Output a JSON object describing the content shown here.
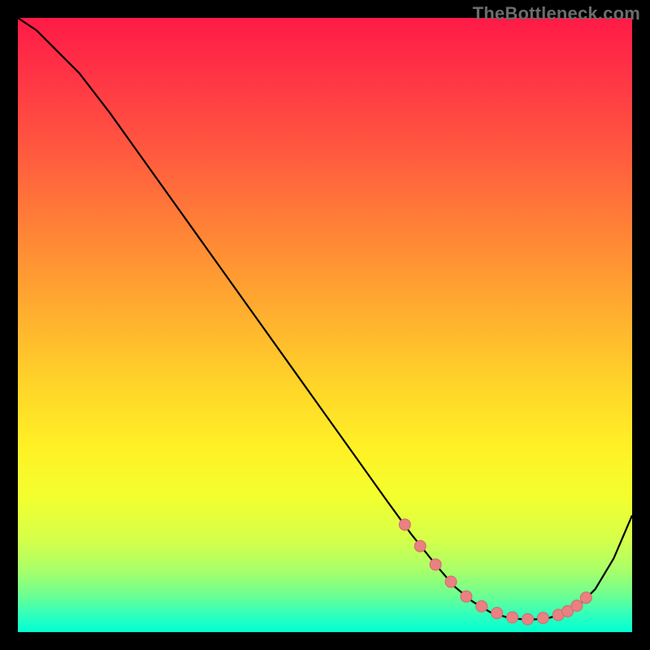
{
  "attribution": "TheBottleneck.com",
  "colors": {
    "bg": "#000000",
    "curve": "#000000",
    "marker_fill": "#e98081",
    "marker_stroke": "#d46a6c",
    "gradient_stops": [
      {
        "offset": 0.0,
        "color": "#ff1a46"
      },
      {
        "offset": 0.1,
        "color": "#ff3645"
      },
      {
        "offset": 0.22,
        "color": "#ff5a3f"
      },
      {
        "offset": 0.35,
        "color": "#ff8436"
      },
      {
        "offset": 0.48,
        "color": "#ffae2f"
      },
      {
        "offset": 0.6,
        "color": "#ffd529"
      },
      {
        "offset": 0.7,
        "color": "#fff126"
      },
      {
        "offset": 0.78,
        "color": "#f3ff2e"
      },
      {
        "offset": 0.85,
        "color": "#d5ff4a"
      },
      {
        "offset": 0.9,
        "color": "#a8ff6a"
      },
      {
        "offset": 0.94,
        "color": "#6dff92"
      },
      {
        "offset": 0.975,
        "color": "#2affc0"
      },
      {
        "offset": 1.0,
        "color": "#00ffd0"
      }
    ]
  },
  "chart_data": {
    "type": "line",
    "title": "",
    "xlabel": "",
    "ylabel": "",
    "xlim": [
      0,
      100
    ],
    "ylim": [
      0,
      100
    ],
    "series": [
      {
        "name": "curve",
        "x": [
          0,
          3,
          6,
          10,
          15,
          20,
          25,
          30,
          35,
          40,
          45,
          50,
          55,
          60,
          64,
          68,
          71,
          74,
          77,
          80,
          83,
          86,
          89,
          91.5,
          94,
          97,
          100
        ],
        "y": [
          100,
          98,
          95,
          91,
          84.5,
          77.5,
          70.5,
          63.5,
          56.5,
          49.5,
          42.5,
          35.5,
          28.5,
          21.5,
          16,
          11,
          7.5,
          5,
          3.2,
          2.3,
          2.0,
          2.2,
          3.0,
          4.5,
          7,
          12,
          19
        ]
      }
    ],
    "markers": {
      "name": "points",
      "x": [
        63,
        65.5,
        68,
        70.5,
        73,
        75.5,
        78,
        80.5,
        83,
        85.5,
        88,
        89.5,
        91,
        92.5
      ],
      "y": [
        17.5,
        14,
        11,
        8.2,
        5.8,
        4.2,
        3.1,
        2.4,
        2.1,
        2.3,
        2.8,
        3.4,
        4.3,
        5.6
      ]
    }
  }
}
